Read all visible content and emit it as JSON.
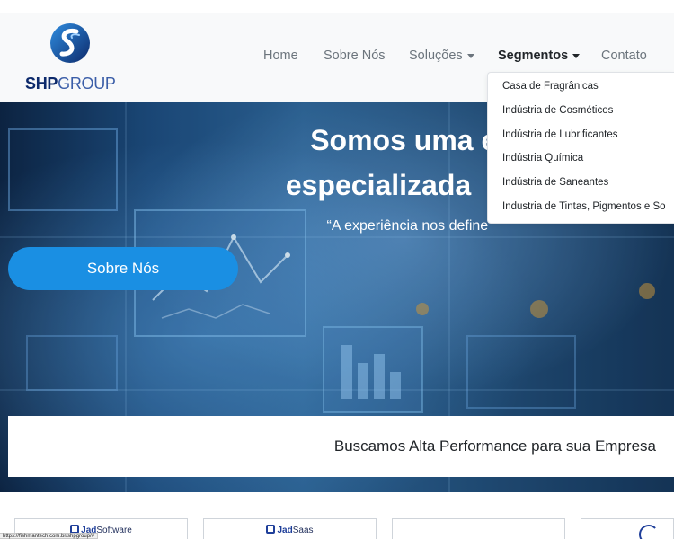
{
  "brand": {
    "logo_shp": "SHP",
    "logo_group": "GROUP",
    "colors": {
      "navy": "#0d2a6b",
      "blue": "#3b5ea8",
      "accent": "#1a8fe3"
    },
    "icon": "shp-swirl-logo-icon"
  },
  "nav": {
    "home": "Home",
    "about": "Sobre Nós",
    "solutions": "Soluções",
    "segments": "Segmentos",
    "contact": "Contato"
  },
  "segments_menu": {
    "items": [
      "Casa de Fragrânicas",
      "Indústria de Cosméticos",
      "Indústria de Lubrificantes",
      "Indústria Química",
      "Indústria de Saneantes",
      "Industria de Tintas, Pigmentos e So"
    ]
  },
  "hero": {
    "title_line1": "Somos uma en",
    "title_line2": "especializada",
    "subtitle": "“A experiência nos define”",
    "button": "Sobre Nós",
    "tagline": "Buscamos Alta Performance para sua Empresa"
  },
  "partners": {
    "card1_a": "Jad",
    "card1_b": "Software",
    "card2_a": "Jad",
    "card2_b": "Saas"
  },
  "status": {
    "url": "https://fishmantech.com.br/shpgroup/#"
  }
}
